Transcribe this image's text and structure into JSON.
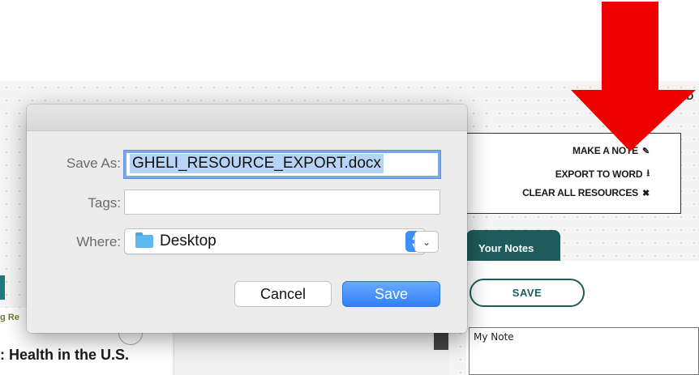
{
  "page": {
    "nav_text": "AD",
    "panel": {
      "make_note": "MAKE A NOTE",
      "export_word": "EXPORT TO WORD",
      "clear_all": "CLEAR ALL RESOURCES"
    },
    "tab_notes": "Your Notes",
    "save_button": "SAVE",
    "note_text": "My Note",
    "left_tag": "g Re",
    "left_title": ": Health in the U.S."
  },
  "dialog": {
    "save_as_label": "Save As:",
    "save_as_value": "GHELI_RESOURCE_EXPORT.docx",
    "tags_label": "Tags:",
    "tags_value": "",
    "where_label": "Where:",
    "where_value": "Desktop",
    "cancel_label": "Cancel",
    "save_label": "Save"
  },
  "icons": {
    "make_note": "pencil-icon",
    "export_word": "download-icon",
    "clear_all": "close-icon",
    "location": "folder-icon",
    "popup": "up-down-chevron-icon",
    "expand": "chevron-down-icon",
    "pointer": "red-arrow-down"
  },
  "colors": {
    "arrow": "#ee0000",
    "teal": "#1f5b5b",
    "accent": "#3f8ef7",
    "selection": "#b7d4f7"
  }
}
